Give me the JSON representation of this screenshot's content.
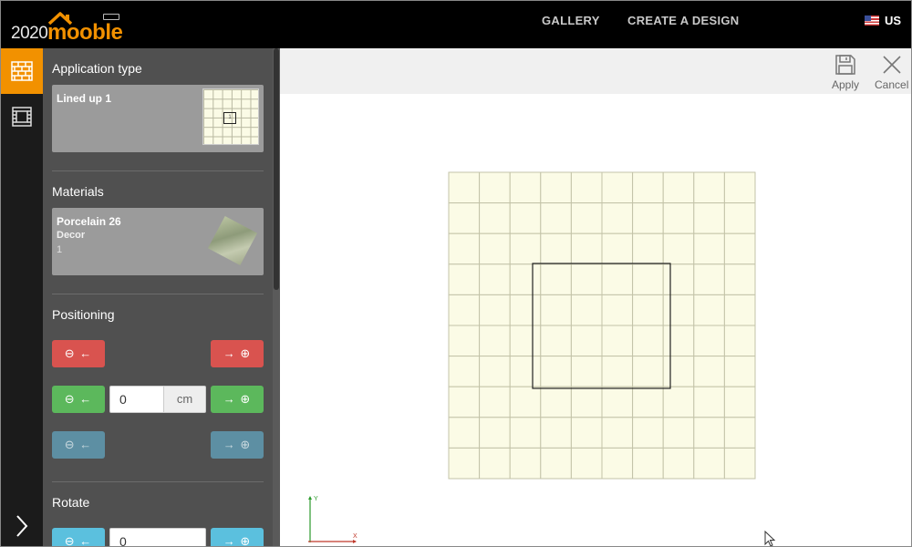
{
  "header": {
    "logo_2020": "2020",
    "logo_mooble": "mooble",
    "nav": [
      "GALLERY",
      "CREATE A DESIGN"
    ],
    "language": "US"
  },
  "sidebar": {
    "application_type": {
      "title": "Application type",
      "card_name": "Lined up 1",
      "thumb_marker": "1"
    },
    "materials": {
      "title": "Materials",
      "card_name": "Porcelain 26",
      "card_sub": "Decor",
      "card_count": "1"
    },
    "positioning": {
      "title": "Positioning",
      "offset_value": "0",
      "unit": "cm"
    },
    "rotate": {
      "title": "Rotate",
      "value": "0"
    }
  },
  "toolbar": {
    "apply_label": "Apply",
    "cancel_label": "Cancel"
  },
  "canvas": {
    "tile_color": "#fbfbe6",
    "grid_color": "#c3c3a8",
    "axis_y_label": "Y",
    "axis_x_label": "X",
    "grid_cols": 10,
    "grid_rows": 10
  },
  "colors": {
    "accent": "#f29100",
    "danger": "#d9534f",
    "success": "#5cb85c",
    "info": "#5bc0de"
  }
}
